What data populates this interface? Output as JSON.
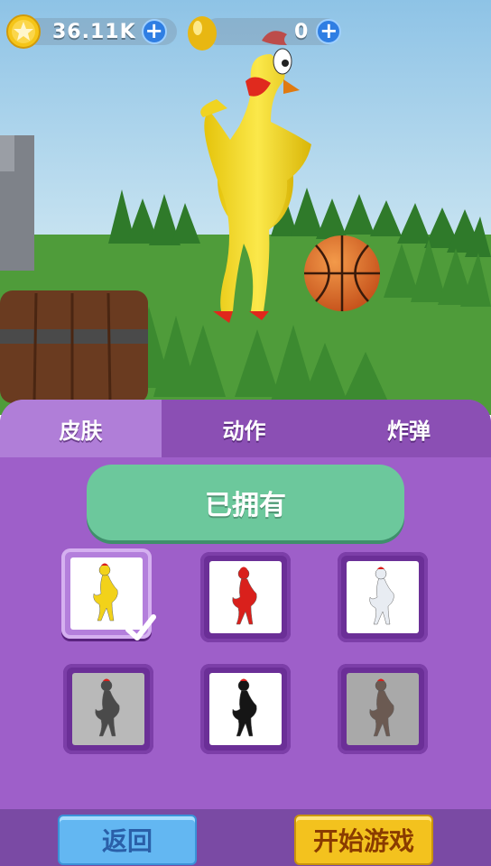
{
  "currency": {
    "coins": {
      "icon": "star-coin-icon",
      "value": "36.11K"
    },
    "eggs": {
      "icon": "golden-egg-icon",
      "value": "0"
    }
  },
  "tabs": [
    {
      "label": "皮肤",
      "active": true
    },
    {
      "label": "动作",
      "active": false
    },
    {
      "label": "炸弹",
      "active": false
    }
  ],
  "owned_label": "已拥有",
  "skins": [
    {
      "icon": "yellow-chicken-icon",
      "color": "#f2d21a",
      "bg": "#ffffff",
      "selected": true
    },
    {
      "icon": "red-chicken-icon",
      "color": "#d9201c",
      "bg": "#ffffff",
      "selected": false
    },
    {
      "icon": "white-chicken-icon",
      "color": "#e8ecf2",
      "bg": "#ffffff",
      "selected": false
    },
    {
      "icon": "gray-bird-icon",
      "color": "#4a4a4a",
      "bg": "#b9b9b9",
      "selected": false
    },
    {
      "icon": "black-chicken-icon",
      "color": "#151515",
      "bg": "#ffffff",
      "selected": false
    },
    {
      "icon": "zombie-bird-icon",
      "color": "#6b5a52",
      "bg": "#a9a9a9",
      "selected": false
    }
  ],
  "buttons": {
    "back": "返回",
    "start": "开始游戏"
  },
  "colors": {
    "panel": "#9e5fc9",
    "owned": "#6cc89c",
    "back": "#63b7f2",
    "start": "#f3c21e"
  }
}
